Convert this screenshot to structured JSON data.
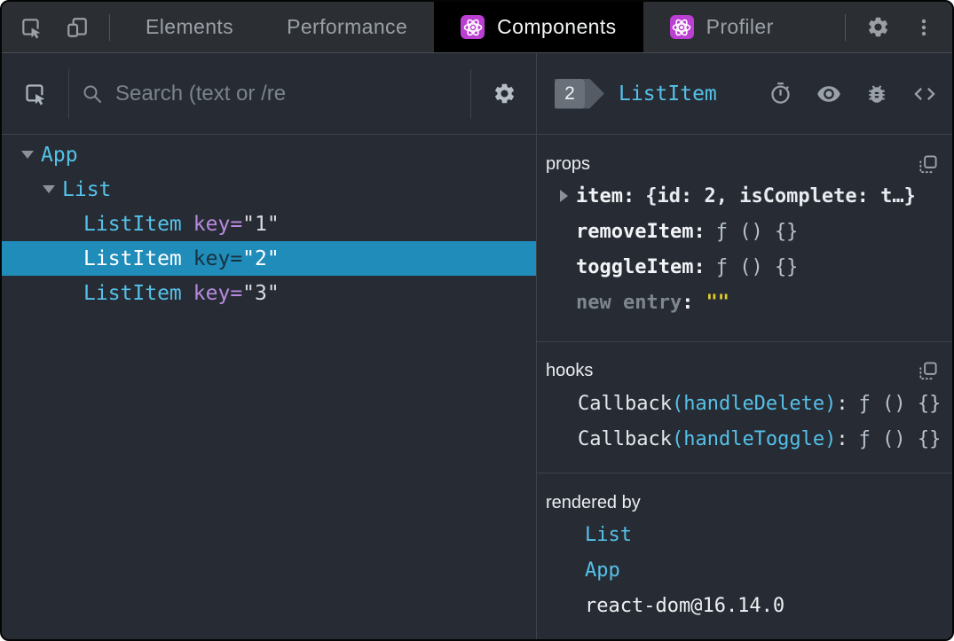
{
  "topbar": {
    "tabs": [
      {
        "label": "Elements"
      },
      {
        "label": "Performance"
      },
      {
        "label": "Components"
      },
      {
        "label": "Profiler"
      }
    ]
  },
  "search": {
    "placeholder": "Search (text or /re"
  },
  "tree": {
    "rows": [
      {
        "name": "App"
      },
      {
        "name": "List"
      },
      {
        "name": "ListItem",
        "attr": "key=",
        "value": "\"1\""
      },
      {
        "name": "ListItem",
        "attr": "key=",
        "value": "\"2\""
      },
      {
        "name": "ListItem",
        "attr": "key=",
        "value": "\"3\""
      }
    ]
  },
  "inspector": {
    "badge": "2",
    "component": "ListItem",
    "props": {
      "title": "props",
      "rows": [
        {
          "name": "item",
          "colon": ":",
          "value": "{id: 2, isComplete: t…}"
        },
        {
          "name": "removeItem",
          "colon": ":",
          "value": "ƒ () {}"
        },
        {
          "name": "toggleItem",
          "colon": ":",
          "value": "ƒ () {}"
        },
        {
          "name": "new entry",
          "colon": ":",
          "value": "\"\""
        }
      ]
    },
    "hooks": {
      "title": "hooks",
      "rows": [
        {
          "fn": "Callback",
          "hook": "(handleDelete)",
          "colon": ":",
          "value": "ƒ () {}"
        },
        {
          "fn": "Callback",
          "hook": "(handleToggle)",
          "colon": ":",
          "value": "ƒ () {}"
        }
      ]
    },
    "rendered_by": {
      "title": "rendered by",
      "rows": [
        {
          "label": "List"
        },
        {
          "label": "App"
        },
        {
          "label": "react-dom@16.14.0"
        }
      ]
    }
  },
  "colors": {
    "accent_cyan": "#55c1e9",
    "attr_purple": "#b88ae0",
    "selected_blue": "#1f8cba",
    "string_yellow": "#e0ca2c",
    "react_purple": "#bc3fd4",
    "panel_bg": "#272c34",
    "topbar_bg": "#2b2f34",
    "active_tab_bg": "#000000"
  }
}
